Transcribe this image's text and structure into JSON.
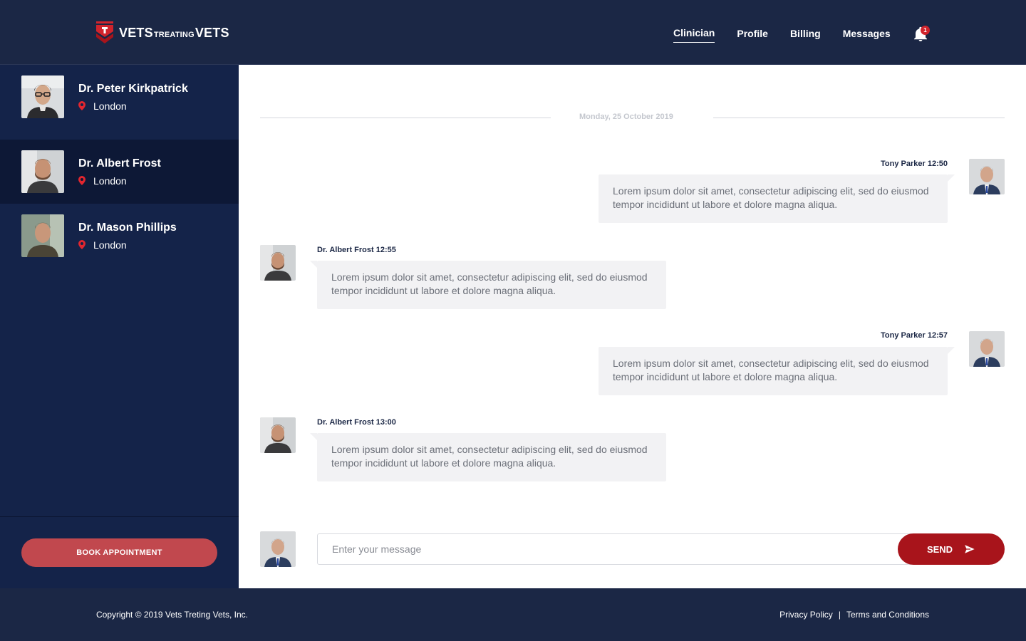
{
  "brand": {
    "part1": "VETS",
    "part2": "TREATING",
    "part3": "VETS",
    "accent_color": "#d1242c"
  },
  "nav": {
    "items": [
      {
        "label": "Clinician",
        "active": true
      },
      {
        "label": "Profile",
        "active": false
      },
      {
        "label": "Billing",
        "active": false
      },
      {
        "label": "Messages",
        "active": false
      }
    ],
    "notification_count": "1"
  },
  "sidebar": {
    "contacts": [
      {
        "name": "Dr. Peter Kirkpatrick",
        "location": "London",
        "active": false
      },
      {
        "name": "Dr. Albert Frost",
        "location": "London",
        "active": true
      },
      {
        "name": "Dr. Mason Phillips",
        "location": "London",
        "active": false
      }
    ],
    "book_label": "BOOK APPOINTMENT"
  },
  "chat": {
    "date": "Monday, 25 October 2019",
    "messages": [
      {
        "sender": "Tony Parker",
        "time": "12:50",
        "header": "Tony Parker 12:50",
        "side": "right",
        "text": "Lorem ipsum dolor sit amet, consectetur adipiscing elit, sed do eiusmod tempor incididunt ut labore et dolore magna aliqua."
      },
      {
        "sender": "Dr. Albert Frost",
        "time": "12:55",
        "header": "Dr. Albert Frost 12:55",
        "side": "left",
        "text": "Lorem ipsum dolor sit amet, consectetur adipiscing elit, sed do eiusmod tempor incididunt ut labore et dolore magna aliqua."
      },
      {
        "sender": "Tony Parker",
        "time": "12:57",
        "header": "Tony Parker 12:57",
        "side": "right",
        "text": "Lorem ipsum dolor sit amet, consectetur adipiscing elit, sed do eiusmod tempor incididunt ut labore et dolore magna aliqua."
      },
      {
        "sender": "Dr. Albert Frost",
        "time": "13:00",
        "header": "Dr. Albert Frost 13:00",
        "side": "left",
        "text": "Lorem ipsum dolor sit amet, consectetur adipiscing elit, sed do eiusmod tempor incididunt ut labore et dolore magna aliqua."
      }
    ],
    "input_placeholder": "Enter your message",
    "input_value": "",
    "send_label": "SEND"
  },
  "footer": {
    "copyright": "Copyright © 2019 Vets Treting Vets, Inc.",
    "privacy": "Privacy Policy",
    "separator": "|",
    "terms": "Terms and Conditions"
  }
}
